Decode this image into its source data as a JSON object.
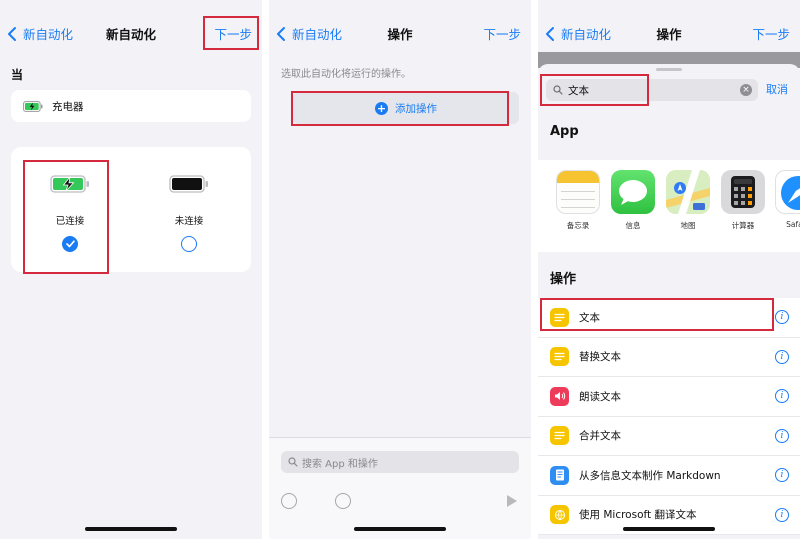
{
  "screen1": {
    "nav": {
      "back_label": "新自动化",
      "title": "新自动化",
      "next_label": "下一步"
    },
    "when_label": "当",
    "trigger": {
      "label": "充电器"
    },
    "options": [
      {
        "label": "已连接",
        "selected": true
      },
      {
        "label": "未连接",
        "selected": false
      }
    ]
  },
  "screen2": {
    "nav": {
      "back_label": "新自动化",
      "title": "操作",
      "next_label": "下一步"
    },
    "hint": "选取此自动化将运行的操作。",
    "add_action_label": "添加操作",
    "search_placeholder": "搜索 App 和操作"
  },
  "screen3": {
    "nav": {
      "back_label": "新自动化",
      "title": "操作",
      "next_label": "下一步"
    },
    "search_value": "文本",
    "cancel_label": "取消",
    "apps_section_title": "App",
    "apps": [
      {
        "name": "备忘录",
        "icon": "notes-icon"
      },
      {
        "name": "信息",
        "icon": "messages-icon"
      },
      {
        "name": "地图",
        "icon": "maps-icon"
      },
      {
        "name": "计算器",
        "icon": "calculator-icon"
      },
      {
        "name": "Safari",
        "icon": "safari-icon"
      }
    ],
    "actions_section_title": "操作",
    "actions": [
      {
        "label": "文本",
        "icon": "text-icon",
        "color": "#f7c500"
      },
      {
        "label": "替换文本",
        "icon": "text-icon",
        "color": "#f7c500"
      },
      {
        "label": "朗读文本",
        "icon": "speaker-icon",
        "color": "#ef3b5a"
      },
      {
        "label": "合并文本",
        "icon": "text-icon",
        "color": "#f7c500"
      },
      {
        "label": "从多信息文本制作 Markdown",
        "icon": "document-icon",
        "color": "#2f8ef2"
      },
      {
        "label": "使用 Microsoft 翻译文本",
        "icon": "translate-icon",
        "color": "#f7c500"
      }
    ]
  },
  "colors": {
    "accent": "#1a7cf5",
    "highlight": "#d52a3e",
    "battery_green": "#34c759"
  }
}
